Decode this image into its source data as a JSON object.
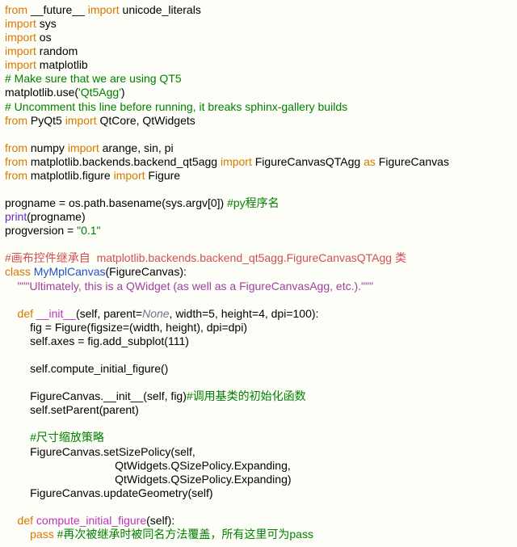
{
  "code": {
    "l1": {
      "a": "from",
      "b": " __future__ ",
      "c": "import",
      "d": " unicode_literals"
    },
    "l2": {
      "a": "import",
      "b": " sys"
    },
    "l3": {
      "a": "import",
      "b": " os"
    },
    "l4": {
      "a": "import",
      "b": " random"
    },
    "l5": {
      "a": "import",
      "b": " matplotlib"
    },
    "l6": "# Make sure that we are using QT5",
    "l7": {
      "a": "matplotlib.use(",
      "b": "'Qt5Agg'",
      "c": ")"
    },
    "l8": "# Uncomment this line before running, it breaks sphinx-gallery builds",
    "l9": {
      "a": "from",
      "b": " PyQt5 ",
      "c": "import",
      "d": " QtCore, QtWidgets"
    },
    "l10": "",
    "l11": {
      "a": "from",
      "b": " numpy ",
      "c": "import",
      "d": " arange, sin, pi"
    },
    "l12": {
      "a": "from",
      "b": " matplotlib.backends.backend_qt5agg ",
      "c": "import",
      "d": " FigureCanvasQTAgg ",
      "e": "as",
      "f": " FigureCanvas"
    },
    "l13": {
      "a": "from",
      "b": " matplotlib.figure ",
      "c": "import",
      "d": " Figure"
    },
    "l14": "",
    "l15": {
      "a": "progname = os.path.basename(sys.argv[0]) ",
      "b": "#py程序名"
    },
    "l16": {
      "a": "print",
      "b": "(progname)"
    },
    "l17": {
      "a": "progversion = ",
      "b": "\"0.1\""
    },
    "l18": "",
    "l19": "#画布控件继承自  matplotlib.backends.backend_qt5agg.FigureCanvasQTAgg 类",
    "l20": {
      "a": "class ",
      "b": "MyMplCanvas",
      "c": "(FigureCanvas):"
    },
    "l21": "    \"\"\"Ultimately, this is a QWidget (as well as a FigureCanvasAgg, etc.).\"\"\"",
    "l22": "",
    "l23": {
      "a": "    def ",
      "b": "__init__",
      "c": "(self, parent=",
      "d": "None",
      "e": ", width=5, height=4, dpi=100):"
    },
    "l24": "        fig = Figure(figsize=(width, height), dpi=dpi)",
    "l25": "        self.axes = fig.add_subplot(111)",
    "l26": "",
    "l27": "        self.compute_initial_figure()",
    "l28": "",
    "l29": {
      "a": "        FigureCanvas.__init__(self, fig)",
      "b": "#调用基类的初始化函数"
    },
    "l30": "        self.setParent(parent)",
    "l31": "",
    "l32": "        #尺寸缩放策略",
    "l33": "        FigureCanvas.setSizePolicy(self,",
    "l34": "                                   QtWidgets.QSizePolicy.Expanding,",
    "l35": "                                   QtWidgets.QSizePolicy.Expanding)",
    "l36": "        FigureCanvas.updateGeometry(self)",
    "l37": "",
    "l38": {
      "a": "    def ",
      "b": "compute_initial_figure",
      "c": "(self):"
    },
    "l39": {
      "a": "        pass ",
      "b": "#再次被继承时被同名方法覆盖，所有这里可为pass"
    }
  }
}
